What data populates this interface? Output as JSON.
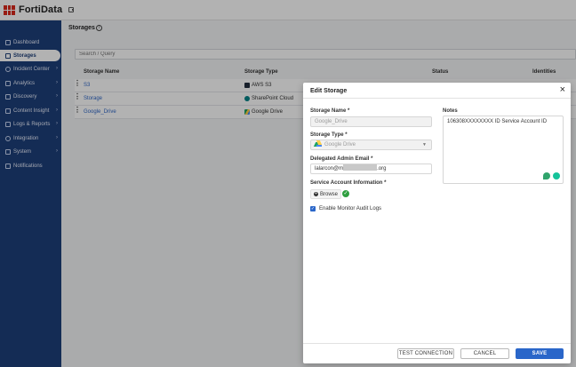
{
  "app": {
    "name": "FortiData"
  },
  "sidebar": {
    "items": [
      {
        "label": "Dashboard",
        "icon": "dashboard-icon",
        "chevron": false
      },
      {
        "label": "Storages",
        "icon": "storage-icon",
        "chevron": false,
        "active": true
      },
      {
        "label": "Incident Center",
        "icon": "incident-icon",
        "chevron": true
      },
      {
        "label": "Analytics",
        "icon": "analytics-icon",
        "chevron": true
      },
      {
        "label": "Discovery",
        "icon": "discovery-icon",
        "chevron": true
      },
      {
        "label": "Content Insight",
        "icon": "content-insight-icon",
        "chevron": true
      },
      {
        "label": "Logs & Reports",
        "icon": "logs-icon",
        "chevron": true
      },
      {
        "label": "Integration",
        "icon": "integration-icon",
        "chevron": true
      },
      {
        "label": "System",
        "icon": "system-icon",
        "chevron": true
      },
      {
        "label": "Notifications",
        "icon": "bell-icon",
        "chevron": false
      }
    ]
  },
  "page": {
    "title": "Storages",
    "search_placeholder": "Search / Query"
  },
  "table": {
    "columns": [
      "Storage Name",
      "Storage Type",
      "Status",
      "Identities"
    ],
    "rows": [
      {
        "name": "S3",
        "type": "AWS S3",
        "type_icon": "aws-icon",
        "type_color": "#232f3e"
      },
      {
        "name": "Storage",
        "type": "SharePoint Cloud",
        "type_icon": "sharepoint-icon",
        "type_color": "#038387"
      },
      {
        "name": "Google_Drive",
        "type": "Google Drive",
        "type_icon": "google-drive-icon",
        "type_color": "#1fa463"
      }
    ]
  },
  "modal": {
    "title": "Edit Storage",
    "fields": {
      "storage_name_label": "Storage Name *",
      "storage_name_value": "Google_Drive",
      "storage_type_label": "Storage Type *",
      "storage_type_value": "Google Drive",
      "admin_email_label": "Delegated Admin Email *",
      "admin_email_prefix": "lalarcon@m",
      "admin_email_suffix": ".org",
      "service_account_label": "Service Account Information *",
      "browse_label": "Browse",
      "notes_label": "Notes",
      "notes_value": "106308XXXXXXXX ID Service Account ID",
      "monitor_audit_label": "Enable Monitor Audit Logs",
      "monitor_audit_checked": true
    },
    "buttons": {
      "test_connection": "TEST CONNECTION",
      "cancel": "CANCEL",
      "save": "SAVE"
    }
  },
  "colors": {
    "sidebar_bg": "#1e3f7a",
    "primary": "#2a66c9",
    "brand_red": "#da291c",
    "link": "#2f67c7",
    "success": "#2e9e3f"
  }
}
